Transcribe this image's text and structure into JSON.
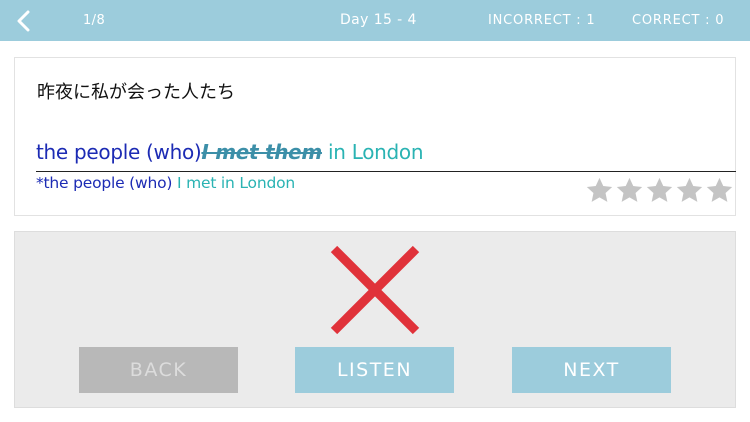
{
  "header": {
    "progress": "1/8",
    "day": "Day 15 - 4",
    "incorrect": "INCORRECT : 1",
    "correct": "CORRECT : 0"
  },
  "question": {
    "japanese": "昨夜に私が会った人たち"
  },
  "answer": {
    "part1": "the people (who)",
    "struck": "I met them",
    "part2": " in London"
  },
  "correction": {
    "prefix": "*the people (who)",
    "rest": " I met in London"
  },
  "rating": {
    "value": 0,
    "max": 5
  },
  "result": {
    "status": "incorrect"
  },
  "buttons": {
    "back": "BACK",
    "listen": "LISTEN",
    "next": "NEXT"
  },
  "colors": {
    "accent": "#9cccdc",
    "wrong_mark": "#e0323a",
    "answer_blue": "#1c2bb4",
    "answer_teal": "#2ab3b3"
  }
}
